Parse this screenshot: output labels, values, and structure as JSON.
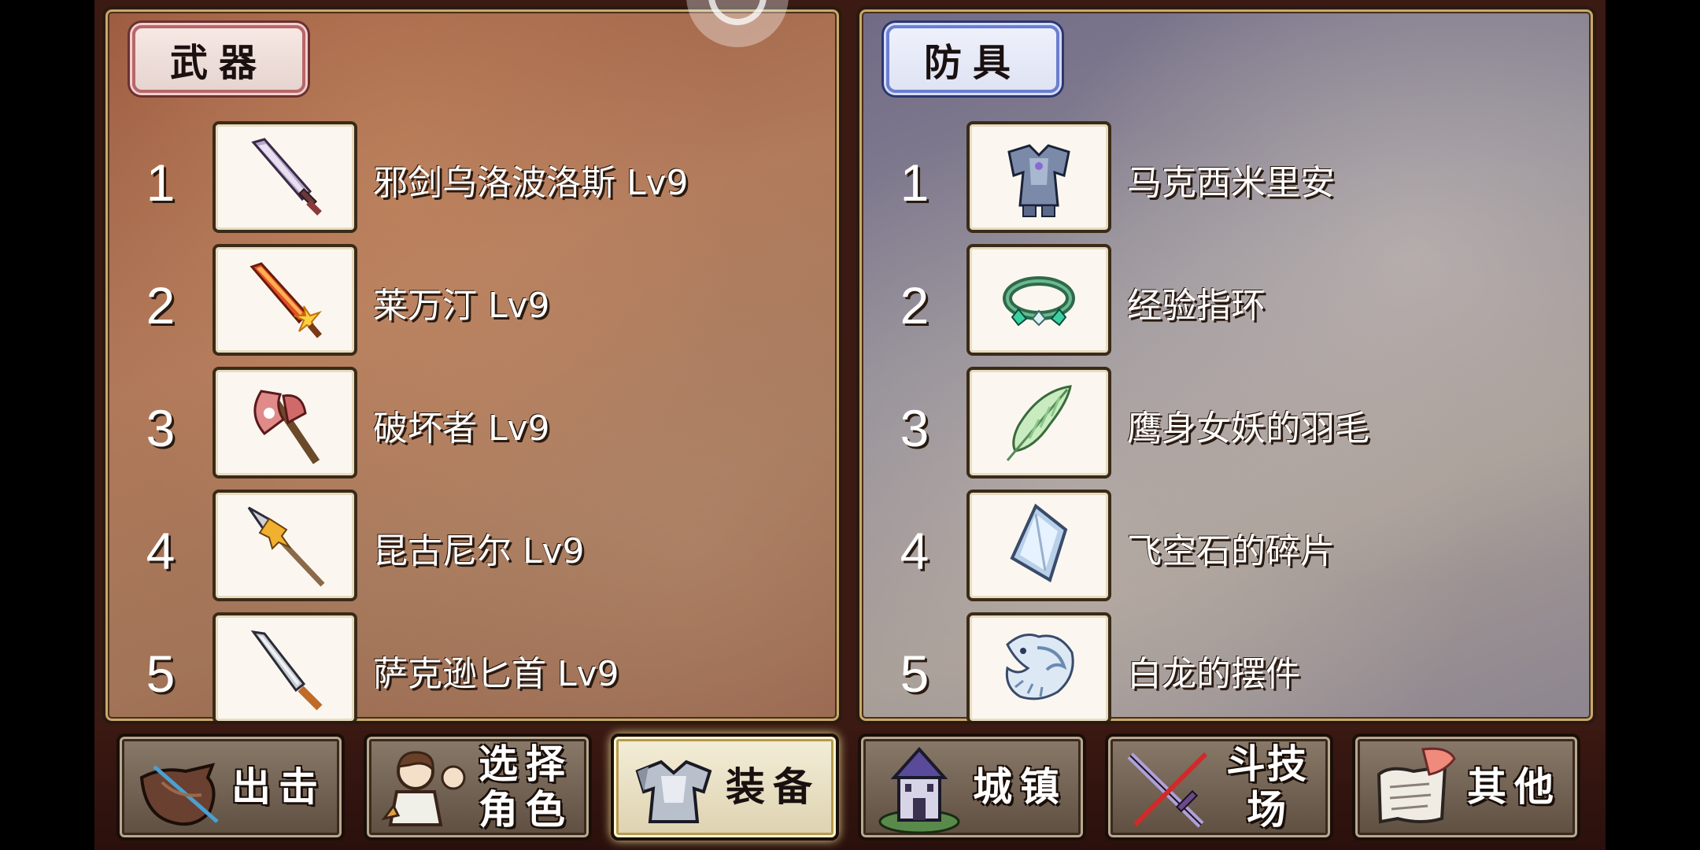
{
  "weapons": {
    "title": "武器",
    "items": [
      {
        "rank": "1",
        "name": "邪剑乌洛波洛斯 Lv9",
        "icon": "dark-sword-icon"
      },
      {
        "rank": "2",
        "name": "莱万汀 Lv9",
        "icon": "flame-sword-icon"
      },
      {
        "rank": "3",
        "name": "破坏者 Lv9",
        "icon": "axe-icon"
      },
      {
        "rank": "4",
        "name": "昆古尼尔 Lv9",
        "icon": "spear-icon"
      },
      {
        "rank": "5",
        "name": "萨克逊匕首 Lv9",
        "icon": "dagger-icon"
      }
    ]
  },
  "armor": {
    "title": "防具",
    "items": [
      {
        "rank": "1",
        "name": "马克西米里安",
        "icon": "plate-armor-icon"
      },
      {
        "rank": "2",
        "name": "经验指环",
        "icon": "ring-icon"
      },
      {
        "rank": "3",
        "name": "鹰身女妖的羽毛",
        "icon": "feather-icon"
      },
      {
        "rank": "4",
        "name": "飞空石的碎片",
        "icon": "crystal-shard-icon"
      },
      {
        "rank": "5",
        "name": "白龙的摆件",
        "icon": "white-dragon-icon"
      }
    ]
  },
  "nav": {
    "sortie": "出击",
    "select_char_1": "选择",
    "select_char_2": "角色",
    "equipment": "装备",
    "town": "城镇",
    "arena": "斗技场",
    "other": "其他"
  },
  "colors": {
    "weapons_panel": "#a8704f",
    "armor_panel": "#8e8894",
    "active_tab": "#efe7cc"
  }
}
